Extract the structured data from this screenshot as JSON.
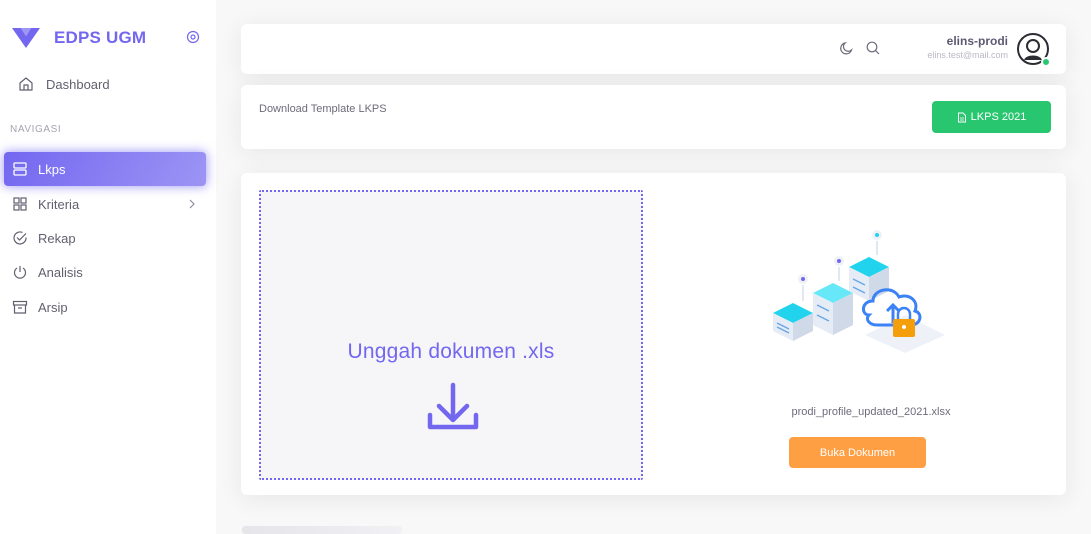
{
  "brand": {
    "name": "EDPS UGM",
    "accent": "#7367f0"
  },
  "sidebar": {
    "dashboard_label": "Dashboard",
    "section_header": "NAVIGASI",
    "items": [
      {
        "label": "Lkps",
        "icon": "server-icon",
        "active": true
      },
      {
        "label": "Kriteria",
        "icon": "grid-icon",
        "has_children": true
      },
      {
        "label": "Rekap",
        "icon": "check-circle-icon"
      },
      {
        "label": "Analisis",
        "icon": "power-icon"
      },
      {
        "label": "Arsip",
        "icon": "archive-icon"
      }
    ]
  },
  "navbar": {
    "icons": [
      "moon-icon",
      "search-icon"
    ],
    "user": {
      "name": "elins-prodi",
      "email": "elins.test@mail.com",
      "status": "online"
    }
  },
  "template_card": {
    "text": "Download Template LKPS",
    "button_label": "LKPS 2021",
    "button_color": "#28c76f"
  },
  "upload": {
    "dropzone_text": "Unggah dokumen .xls",
    "file_name": "prodi_profile_updated_2021.xlsx",
    "open_button_label": "Buka Dokumen",
    "open_button_color": "#ff9f43"
  }
}
